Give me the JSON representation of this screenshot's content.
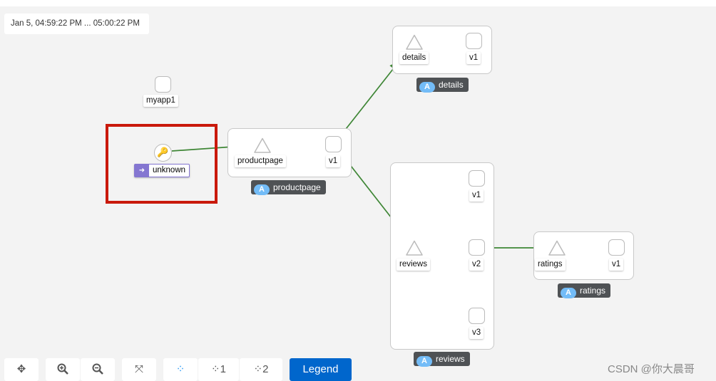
{
  "time_range": "Jan 5, 04:59:22 PM ... 05:00:22 PM",
  "nodes": {
    "myapp1": "myapp1",
    "unknown": "unknown",
    "productpage": {
      "service": "productpage",
      "version": "v1",
      "app": "productpage"
    },
    "details": {
      "service": "details",
      "version": "v1",
      "app": "details"
    },
    "reviews": {
      "service": "reviews",
      "versions": [
        "v1",
        "v2",
        "v3"
      ],
      "app": "reviews"
    },
    "ratings": {
      "service": "ratings",
      "version": "v1",
      "app": "ratings"
    }
  },
  "app_badge_letter": "A",
  "toolbar": {
    "layout1": "1",
    "layout2": "2",
    "legend": "Legend"
  },
  "watermark": "CSDN @你大晨哥",
  "colors": {
    "edge": "#3e8635",
    "highlight": "#c9190b",
    "legend_button": "#0066cc",
    "badge_a": "#73bcf7",
    "unknown": "#8476d1"
  }
}
